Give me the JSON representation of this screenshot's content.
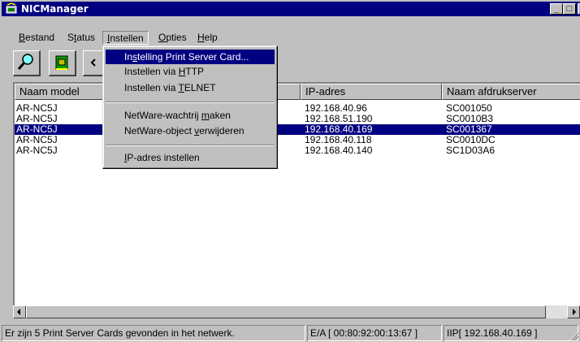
{
  "window": {
    "title": "NICManager",
    "minimize_glyph": "_",
    "maximize_glyph": "□",
    "close_glyph": "×"
  },
  "menubar": {
    "items": [
      {
        "pre": "",
        "accel": "B",
        "post": "estand"
      },
      {
        "pre": "S",
        "accel": "t",
        "post": "atus"
      },
      {
        "pre": "",
        "accel": "I",
        "post": "nstellen"
      },
      {
        "pre": "",
        "accel": "O",
        "post": "pties"
      },
      {
        "pre": "",
        "accel": "H",
        "post": "elp"
      }
    ]
  },
  "toolbar": {
    "buttons": [
      {
        "icon": "magnifier-icon"
      },
      {
        "icon": "network-card-icon"
      },
      {
        "icon": "arrow-icon"
      }
    ]
  },
  "dropdown": {
    "items": [
      {
        "pre": "In",
        "accel": "s",
        "post": "telling Print Server Card...",
        "highlighted": true
      },
      {
        "pre": "Instellen via ",
        "accel": "H",
        "post": "TTP"
      },
      {
        "pre": "Instellen via ",
        "accel": "T",
        "post": "ELNET"
      },
      {
        "pre": "NetWare-wachtrij ",
        "accel": "m",
        "post": "aken"
      },
      {
        "pre": "NetWare-object ",
        "accel": "v",
        "post": "erwijderen"
      },
      {
        "pre": "",
        "accel": "I",
        "post": "P-adres instellen"
      }
    ]
  },
  "table": {
    "columns": [
      "Naam model",
      "",
      "IP-adres",
      "Naam afdrukserver"
    ],
    "rows": [
      {
        "model": "AR-NC5J",
        "ip": "192.168.40.96",
        "server": "SC001050",
        "selected": false
      },
      {
        "model": "AR-NC5J",
        "ip": "192.168.51.190",
        "server": "SC0010B3",
        "selected": false
      },
      {
        "model": "AR-NC5J",
        "ip": "192.168.40.169",
        "server": "SC001367",
        "selected": true
      },
      {
        "model": "AR-NC5J",
        "ip": "192.168.40.118",
        "server": "SC0010DC",
        "selected": false
      },
      {
        "model": "AR-NC5J",
        "ip": "192.168.40.140",
        "server": "SC1D03A6",
        "selected": false
      }
    ]
  },
  "statusbar": {
    "message": "Er zijn  5 Print Server Cards gevonden in het netwerk.",
    "mac": "E/A [ 00:80:92:00:13:67 ]",
    "ip": "IIP[ 192.168.40.169 ]"
  },
  "colors": {
    "titlebar": "#000080",
    "selection": "#000080",
    "face": "#c0c0c0"
  }
}
